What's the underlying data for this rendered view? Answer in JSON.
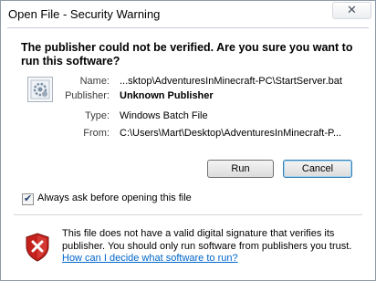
{
  "window": {
    "title": "Open File - Security Warning",
    "close_symbol": "✕"
  },
  "heading": "The publisher could not be verified.  Are you sure you want to run this software?",
  "fields": [
    {
      "label": "Name:",
      "value": "...sktop\\AdventuresInMinecraft-PC\\StartServer.bat"
    },
    {
      "label": "Publisher:",
      "value": "Unknown Publisher"
    },
    {
      "label": "Type:",
      "value": "Windows Batch File"
    },
    {
      "label": "From:",
      "value": "C:\\Users\\Mart\\Desktop\\AdventuresInMinecraft-P..."
    }
  ],
  "buttons": {
    "run": "Run",
    "cancel": "Cancel"
  },
  "checkbox": {
    "label": "Always ask before opening this file",
    "checked": true,
    "check_symbol": "✔"
  },
  "warning": {
    "text": "This file does not have a valid digital signature that verifies its publisher.  You should only run software from publishers you trust.",
    "link": "How can I decide what software to run?"
  },
  "colors": {
    "link": "#0066cc",
    "shield_red": "#c4211c"
  }
}
